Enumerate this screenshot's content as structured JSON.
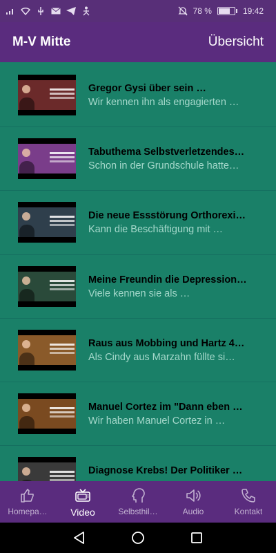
{
  "status_bar": {
    "battery_percent": "78 %",
    "battery_level": 0.78,
    "time": "19:42",
    "icons": [
      "signal-icon",
      "wifi-icon",
      "usb-icon",
      "mail-icon",
      "telegram-icon",
      "person-icon",
      "mute-bell-icon",
      "battery-icon"
    ]
  },
  "app_bar": {
    "title": "M-V Mitte",
    "action": "Übersicht"
  },
  "videos": [
    {
      "title": "Gregor Gysi über sein …",
      "description": "Wir kennen ihn als engagierten …",
      "thumb_color": "#6b2a2a"
    },
    {
      "title": "Tabuthema Selbstverletzendes…",
      "description": "Schon in der Grundschule hatte…",
      "thumb_color": "#7a3d8a"
    },
    {
      "title": "Die neue Essstörung Orthorexi…",
      "description": "Kann die Beschäftigung mit …",
      "thumb_color": "#2f3f4c"
    },
    {
      "title": "Meine Freundin die Depression…",
      "description": "Viele kennen sie als …",
      "thumb_color": "#2a4a3a"
    },
    {
      "title": "Raus aus Mobbing und Hartz 4…",
      "description": "Als Cindy aus Marzahn füllte si…",
      "thumb_color": "#8a5a2a"
    },
    {
      "title": "Manuel Cortez im \"Dann eben …",
      "description": "Wir haben Manuel Cortez in …",
      "thumb_color": "#7a4a20"
    },
    {
      "title": "Diagnose Krebs! Der Politiker …",
      "description": "",
      "thumb_color": "#3a3a3a"
    }
  ],
  "bottom_nav": [
    {
      "label": "Homepa…",
      "icon": "thumbs-up-icon",
      "active": false
    },
    {
      "label": "Video",
      "icon": "tv-icon",
      "active": true
    },
    {
      "label": "Selbsthil…",
      "icon": "head-profile-icon",
      "active": false
    },
    {
      "label": "Audio",
      "icon": "speaker-icon",
      "active": false
    },
    {
      "label": "Kontakt",
      "icon": "phone-icon",
      "active": false
    }
  ],
  "colors": {
    "purple": "#5a2c7e",
    "green": "#1a8068",
    "description_text": "#a5d8cb"
  }
}
